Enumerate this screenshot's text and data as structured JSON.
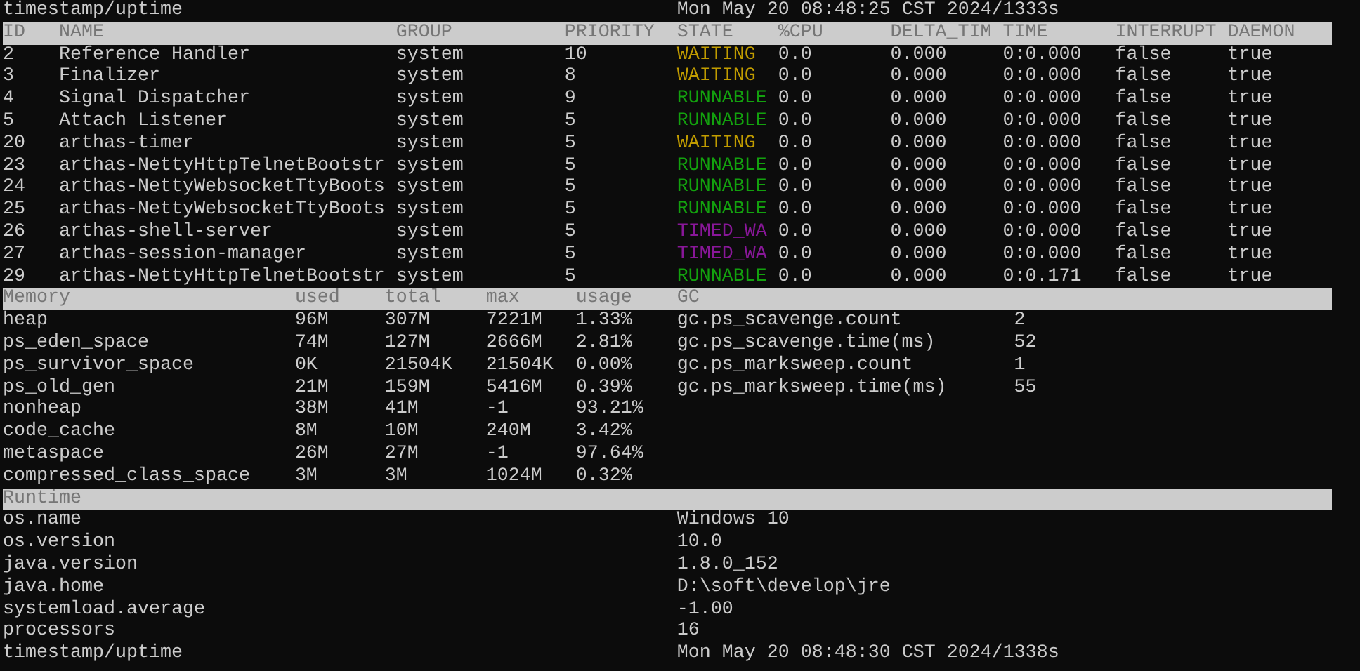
{
  "top_line": {
    "label": "timestamp/uptime",
    "value": "Mon May 20 08:48:25 CST 2024/1333s"
  },
  "threads": {
    "columns": [
      "ID",
      "NAME",
      "GROUP",
      "PRIORITY",
      "STATE",
      "%CPU",
      "DELTA_TIM",
      "TIME",
      "INTERRUPT",
      "DAEMON"
    ],
    "rows": [
      {
        "id": "2",
        "name": "Reference Handler",
        "group": "system",
        "priority": "10",
        "state": "WAITING",
        "color": "#c19c00",
        "cpu": "0.0",
        "delta": "0.000",
        "time": "0:0.000",
        "interrupt": "false",
        "daemon": "true"
      },
      {
        "id": "3",
        "name": "Finalizer",
        "group": "system",
        "priority": "8",
        "state": "WAITING",
        "color": "#c19c00",
        "cpu": "0.0",
        "delta": "0.000",
        "time": "0:0.000",
        "interrupt": "false",
        "daemon": "true"
      },
      {
        "id": "4",
        "name": "Signal Dispatcher",
        "group": "system",
        "priority": "9",
        "state": "RUNNABLE",
        "color": "#13a10e",
        "cpu": "0.0",
        "delta": "0.000",
        "time": "0:0.000",
        "interrupt": "false",
        "daemon": "true"
      },
      {
        "id": "5",
        "name": "Attach Listener",
        "group": "system",
        "priority": "5",
        "state": "RUNNABLE",
        "color": "#13a10e",
        "cpu": "0.0",
        "delta": "0.000",
        "time": "0:0.000",
        "interrupt": "false",
        "daemon": "true"
      },
      {
        "id": "20",
        "name": "arthas-timer",
        "group": "system",
        "priority": "5",
        "state": "WAITING",
        "color": "#c19c00",
        "cpu": "0.0",
        "delta": "0.000",
        "time": "0:0.000",
        "interrupt": "false",
        "daemon": "true"
      },
      {
        "id": "23",
        "name": "arthas-NettyHttpTelnetBootstr",
        "group": "system",
        "priority": "5",
        "state": "RUNNABLE",
        "color": "#13a10e",
        "cpu": "0.0",
        "delta": "0.000",
        "time": "0:0.000",
        "interrupt": "false",
        "daemon": "true"
      },
      {
        "id": "24",
        "name": "arthas-NettyWebsocketTtyBoots",
        "group": "system",
        "priority": "5",
        "state": "RUNNABLE",
        "color": "#13a10e",
        "cpu": "0.0",
        "delta": "0.000",
        "time": "0:0.000",
        "interrupt": "false",
        "daemon": "true"
      },
      {
        "id": "25",
        "name": "arthas-NettyWebsocketTtyBoots",
        "group": "system",
        "priority": "5",
        "state": "RUNNABLE",
        "color": "#13a10e",
        "cpu": "0.0",
        "delta": "0.000",
        "time": "0:0.000",
        "interrupt": "false",
        "daemon": "true"
      },
      {
        "id": "26",
        "name": "arthas-shell-server",
        "group": "system",
        "priority": "5",
        "state": "TIMED_WA",
        "color": "#881798",
        "cpu": "0.0",
        "delta": "0.000",
        "time": "0:0.000",
        "interrupt": "false",
        "daemon": "true"
      },
      {
        "id": "27",
        "name": "arthas-session-manager",
        "group": "system",
        "priority": "5",
        "state": "TIMED_WA",
        "color": "#881798",
        "cpu": "0.0",
        "delta": "0.000",
        "time": "0:0.000",
        "interrupt": "false",
        "daemon": "true"
      },
      {
        "id": "29",
        "name": "arthas-NettyHttpTelnetBootstr",
        "group": "system",
        "priority": "5",
        "state": "RUNNABLE",
        "color": "#13a10e",
        "cpu": "0.0",
        "delta": "0.000",
        "time": "0:0.171",
        "interrupt": "false",
        "daemon": "true"
      }
    ]
  },
  "memory": {
    "columns": [
      "Memory",
      "used",
      "total",
      "max",
      "usage"
    ],
    "rows": [
      {
        "name": "heap",
        "used": "96M",
        "total": "307M",
        "max": "7221M",
        "usage": "1.33%"
      },
      {
        "name": "ps_eden_space",
        "used": "74M",
        "total": "127M",
        "max": "2666M",
        "usage": "2.81%"
      },
      {
        "name": "ps_survivor_space",
        "used": "0K",
        "total": "21504K",
        "max": "21504K",
        "usage": "0.00%"
      },
      {
        "name": "ps_old_gen",
        "used": "21M",
        "total": "159M",
        "max": "5416M",
        "usage": "0.39%"
      },
      {
        "name": "nonheap",
        "used": "38M",
        "total": "41M",
        "max": "-1",
        "usage": "93.21%"
      },
      {
        "name": "code_cache",
        "used": "8M",
        "total": "10M",
        "max": "240M",
        "usage": "3.42%"
      },
      {
        "name": "metaspace",
        "used": "26M",
        "total": "27M",
        "max": "-1",
        "usage": "97.64%"
      },
      {
        "name": "compressed_class_space",
        "used": "3M",
        "total": "3M",
        "max": "1024M",
        "usage": "0.32%"
      }
    ]
  },
  "gc": {
    "title": "GC",
    "rows": [
      {
        "name": "gc.ps_scavenge.count",
        "value": "2"
      },
      {
        "name": "gc.ps_scavenge.time(ms)",
        "value": "52"
      },
      {
        "name": "gc.ps_marksweep.count",
        "value": "1"
      },
      {
        "name": "gc.ps_marksweep.time(ms)",
        "value": "55"
      }
    ]
  },
  "runtime": {
    "title": "Runtime",
    "rows": [
      {
        "name": "os.name",
        "value": "Windows 10"
      },
      {
        "name": "os.version",
        "value": "10.0"
      },
      {
        "name": "java.version",
        "value": "1.8.0_152"
      },
      {
        "name": "java.home",
        "value": "D:\\soft\\develop\\jre"
      },
      {
        "name": "systemload.average",
        "value": "-1.00"
      },
      {
        "name": "processors",
        "value": "16"
      },
      {
        "name": "timestamp/uptime",
        "value": "Mon May 20 08:48:30 CST 2024/1338s"
      }
    ]
  }
}
